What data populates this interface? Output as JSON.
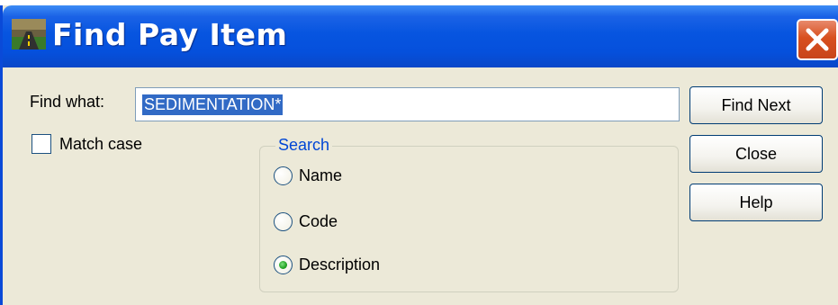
{
  "window": {
    "title": "Find Pay Item",
    "icon": "landscape-app-icon",
    "close_icon": "close-x-icon",
    "title_color": "#0755e0",
    "close_color": "#d8501f"
  },
  "find": {
    "label": "Find what:",
    "value": "SEDIMENTATION*"
  },
  "match_case": {
    "label": "Match case",
    "checked": false
  },
  "search": {
    "legend": "Search",
    "options": [
      {
        "label": "Name",
        "selected": false
      },
      {
        "label": "Code",
        "selected": false
      },
      {
        "label": "Description",
        "selected": true
      }
    ]
  },
  "buttons": {
    "find_next": "Find Next",
    "close": "Close",
    "help": "Help"
  }
}
